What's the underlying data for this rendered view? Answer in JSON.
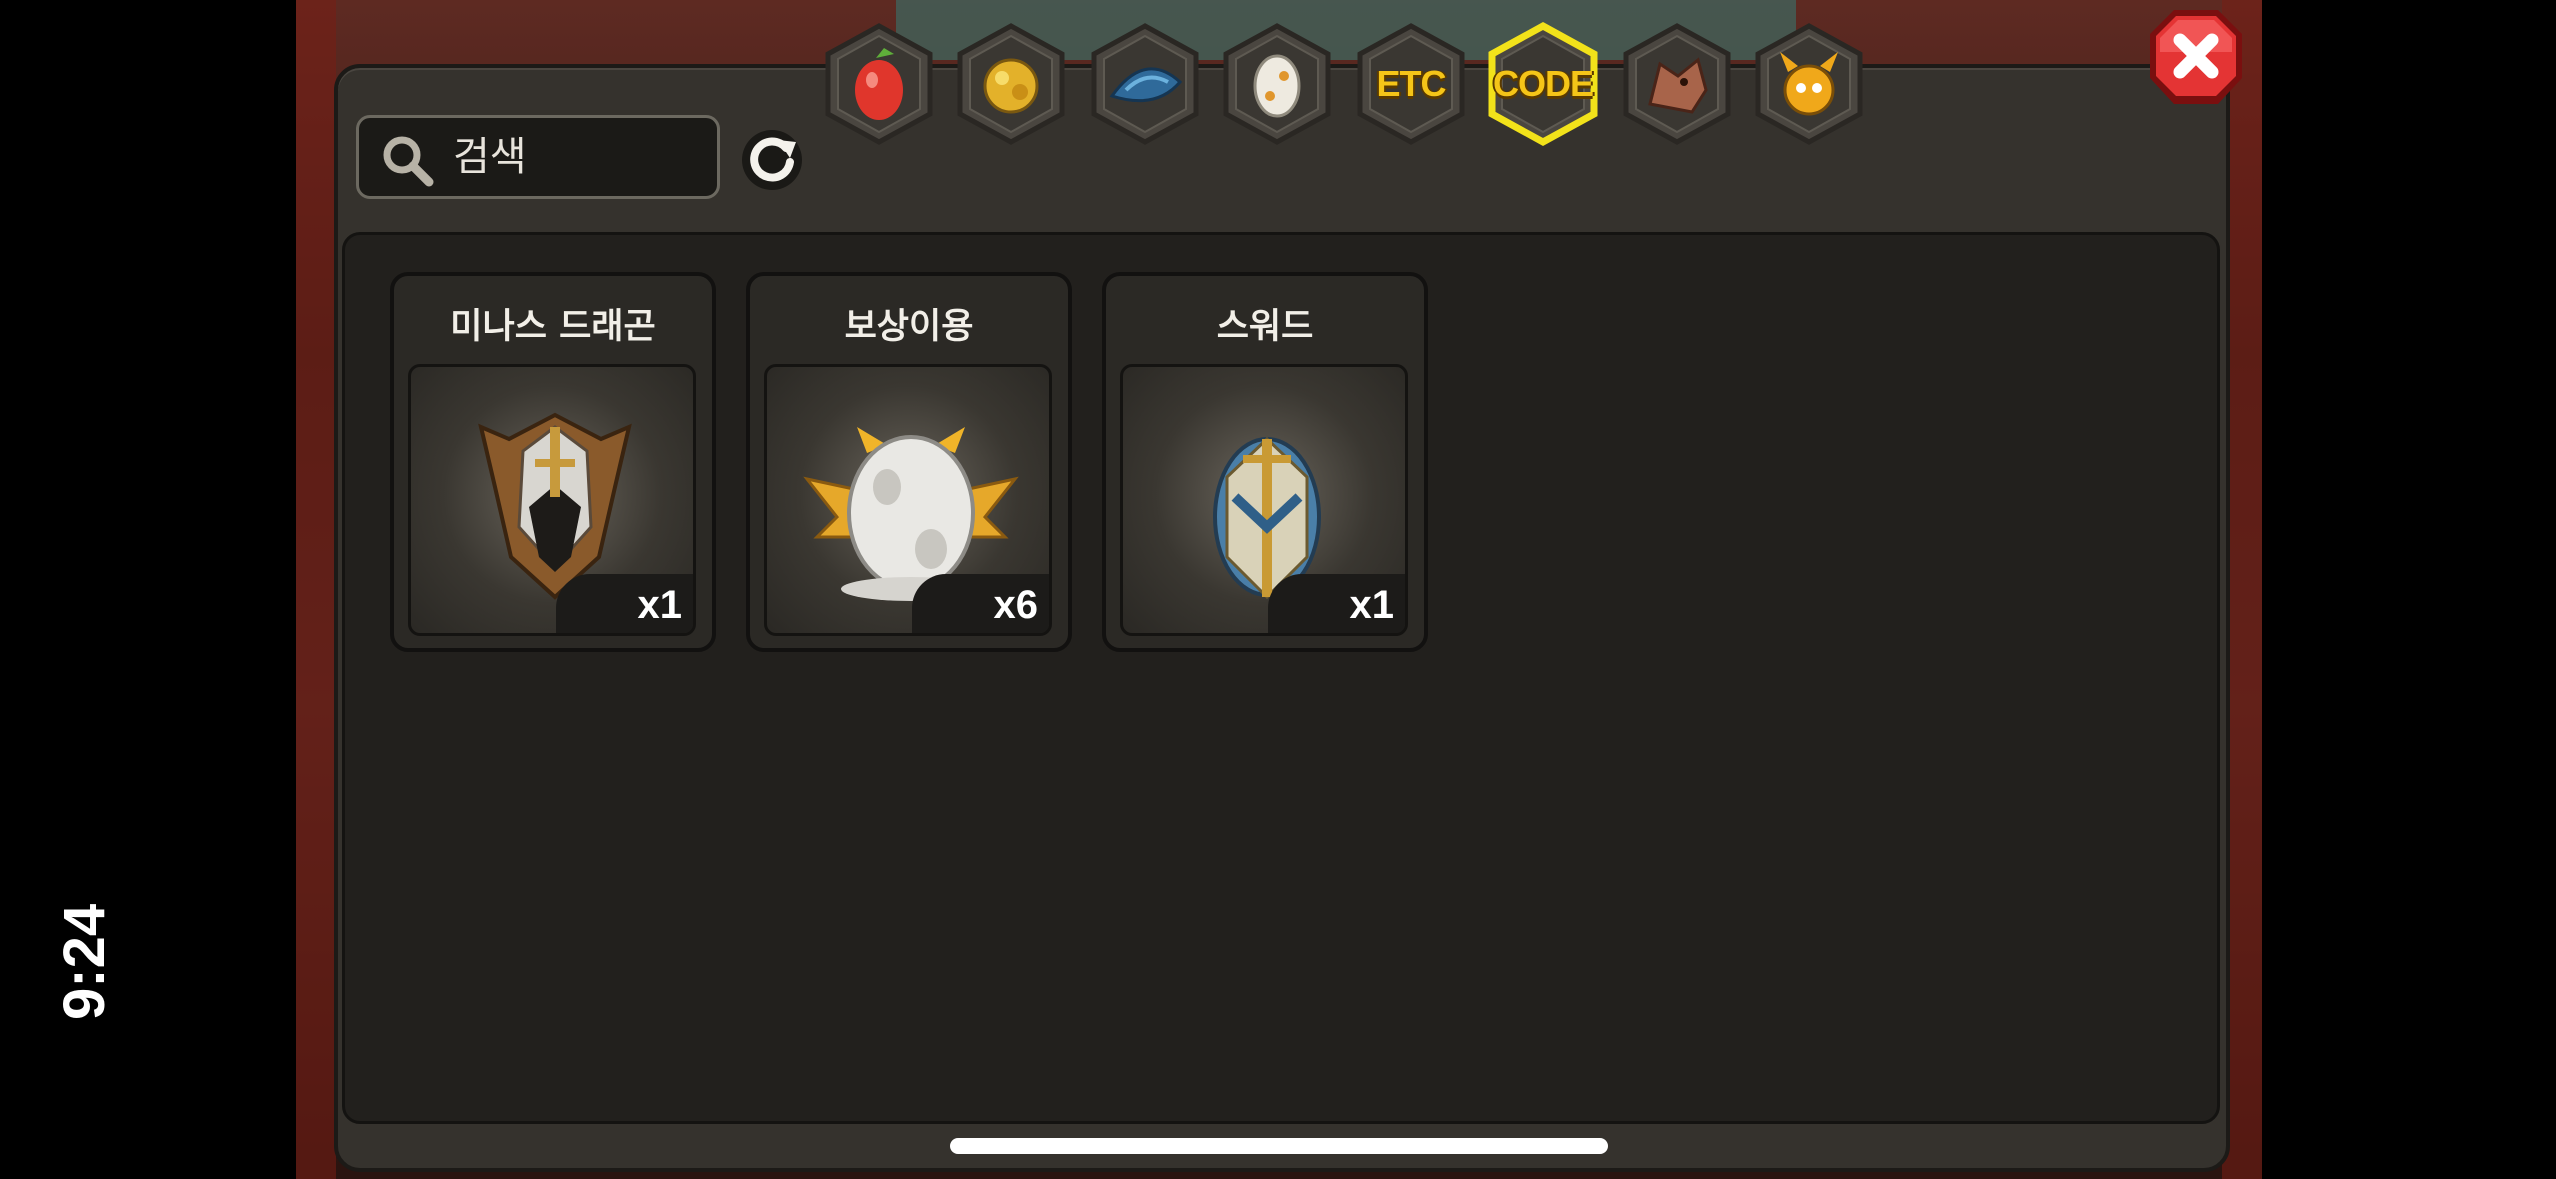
{
  "status_bar": {
    "time": "9:24"
  },
  "search": {
    "placeholder": "검색"
  },
  "tabs": [
    {
      "id": "fruit",
      "icon": "red-fruit-icon",
      "label": ""
    },
    {
      "id": "gold",
      "icon": "gold-ore-icon",
      "label": ""
    },
    {
      "id": "scale",
      "icon": "blue-scale-icon",
      "label": ""
    },
    {
      "id": "egg",
      "icon": "egg-icon",
      "label": ""
    },
    {
      "id": "etc",
      "icon": "",
      "label": "ETC"
    },
    {
      "id": "code",
      "icon": "",
      "label": "CODE",
      "selected": true
    },
    {
      "id": "dragon",
      "icon": "dragon-head-icon",
      "label": ""
    },
    {
      "id": "mascot",
      "icon": "horned-mascot-icon",
      "label": ""
    }
  ],
  "items": [
    {
      "title": "미나스 드래곤",
      "icon": "dragon-helmet-icon",
      "quantity": "x1"
    },
    {
      "title": "보상이용",
      "icon": "winged-egg-icon",
      "quantity": "x6"
    },
    {
      "title": "스워드",
      "icon": "armored-egg-icon",
      "quantity": "x1"
    }
  ],
  "colors": {
    "selected_tab_border": "#f2e21a",
    "tab_label": "#f5c518",
    "close_button": "#d42a2a"
  }
}
